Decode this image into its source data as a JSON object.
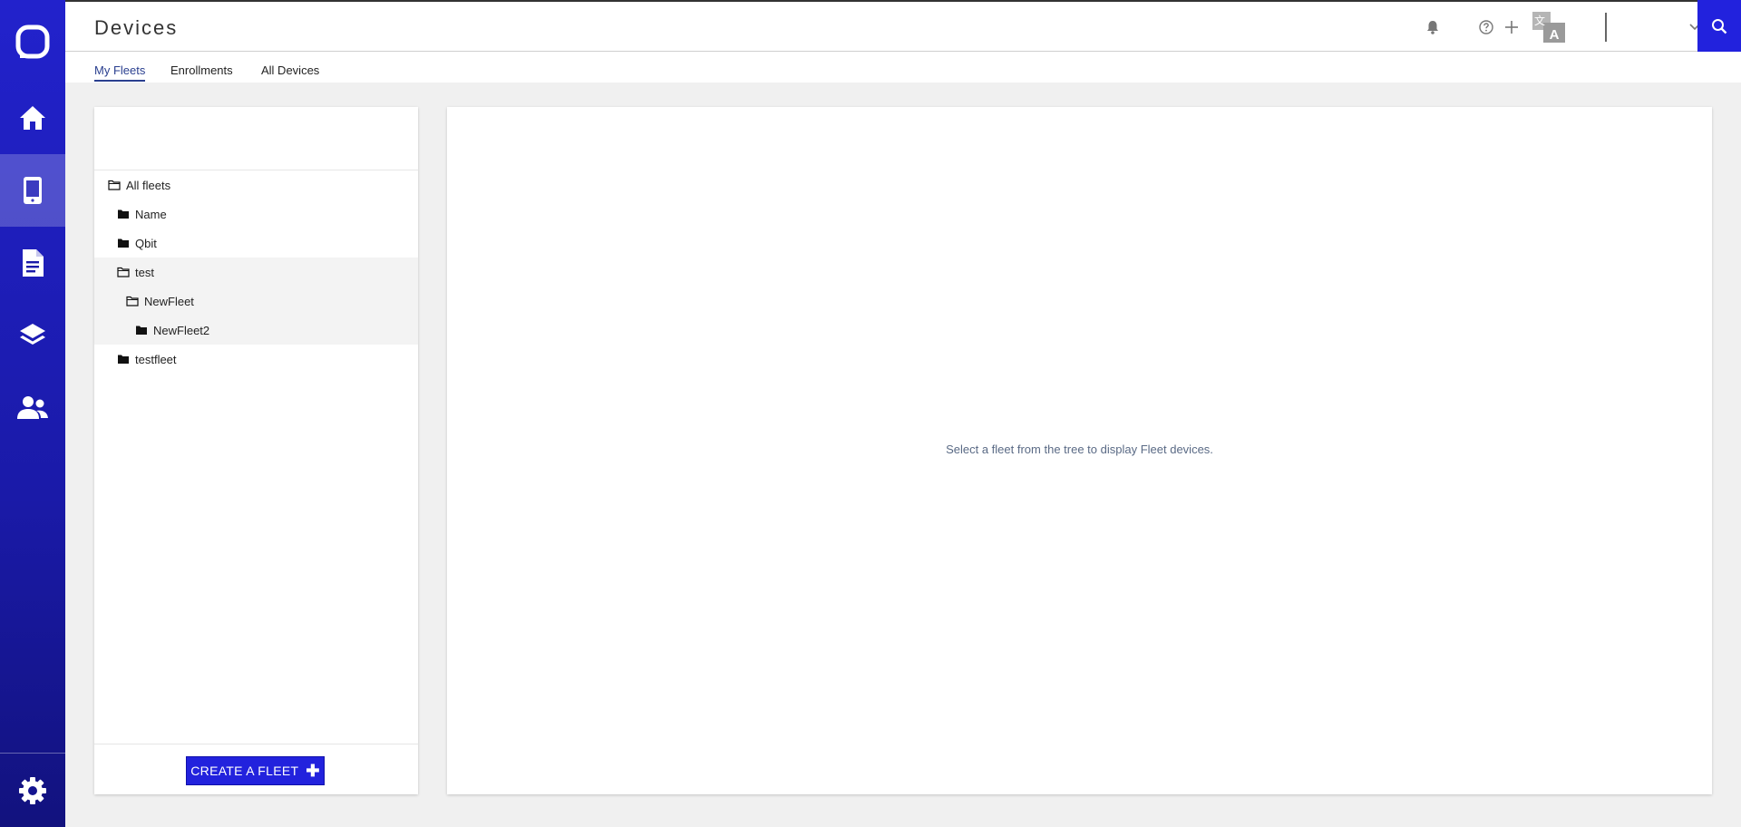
{
  "header": {
    "title": "Devices",
    "icons": [
      "bell-icon",
      "help-icon",
      "plus-icon",
      "translate-icon",
      "chevron-down-icon",
      "user-icon",
      "search-icon"
    ]
  },
  "nav": {
    "items": [
      {
        "name": "home",
        "icon": "home-icon"
      },
      {
        "name": "devices",
        "icon": "phone-icon",
        "active": true
      },
      {
        "name": "documents",
        "icon": "document-icon"
      },
      {
        "name": "layers",
        "icon": "layers-icon"
      },
      {
        "name": "users",
        "icon": "users-icon"
      },
      {
        "name": "settings",
        "icon": "gear-icon"
      }
    ]
  },
  "tabs": [
    {
      "label": "My Fleets",
      "active": true
    },
    {
      "label": "Enrollments"
    },
    {
      "label": "All Devices"
    }
  ],
  "tree": {
    "nodes": [
      {
        "label": "All fleets",
        "depth": 0,
        "open": true
      },
      {
        "label": "Name",
        "depth": 1,
        "open": false
      },
      {
        "label": "Qbit",
        "depth": 1,
        "open": false
      },
      {
        "label": "test",
        "depth": 1,
        "open": true,
        "selected": true
      },
      {
        "label": "NewFleet",
        "depth": 2,
        "open": true,
        "selected": true
      },
      {
        "label": "NewFleet2",
        "depth": 3,
        "open": false,
        "selected": true
      },
      {
        "label": "testfleet",
        "depth": 1,
        "open": false
      }
    ],
    "create_label": "CREATE A FLEET"
  },
  "detail": {
    "empty_message": "Select a fleet from the tree to display Fleet devices."
  },
  "colors": {
    "accent": "#2222dd",
    "rail": "#1a1aa8",
    "tab_active": "#2a3f8f"
  }
}
